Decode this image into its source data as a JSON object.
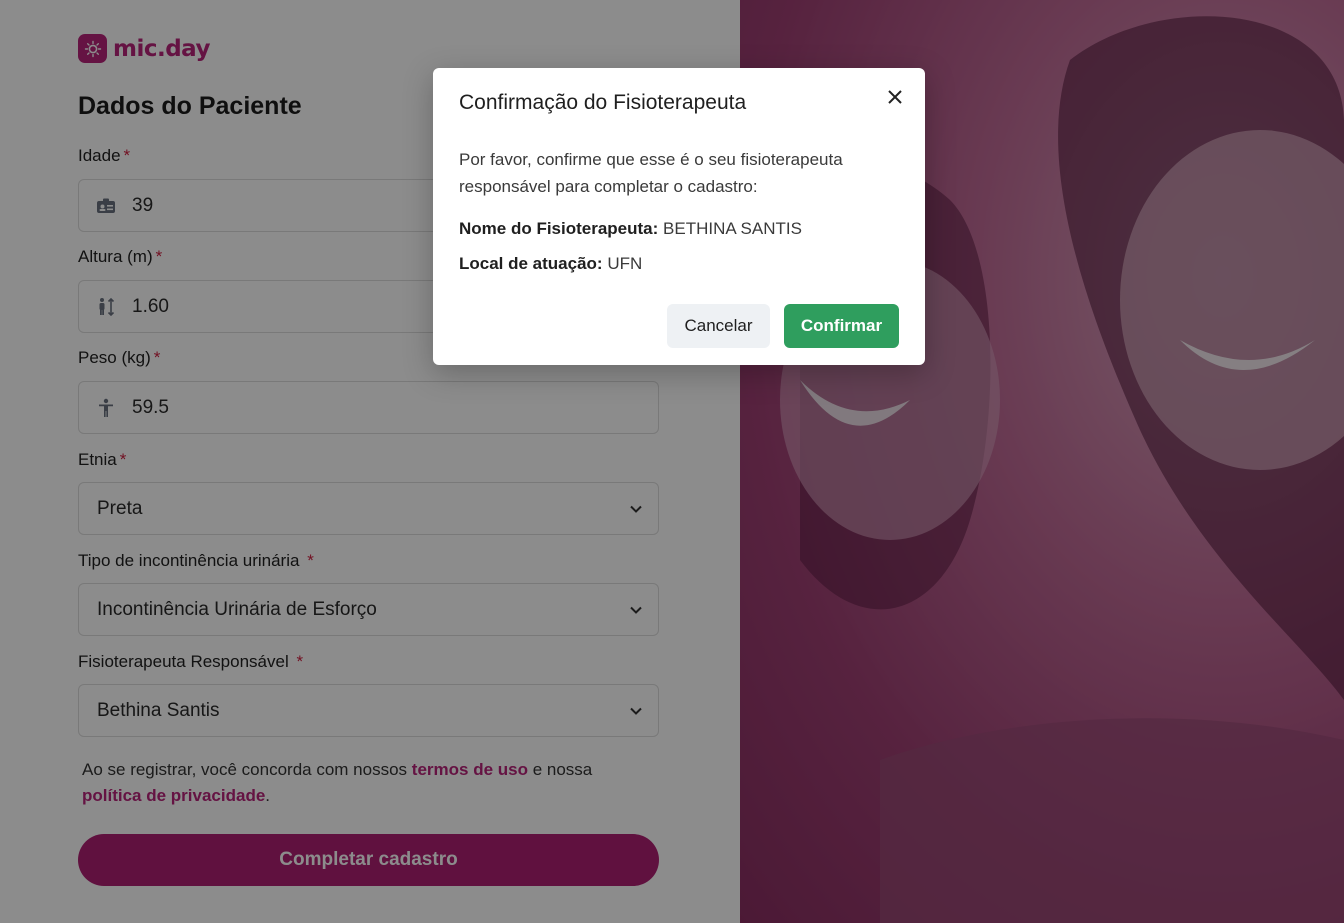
{
  "brand": {
    "name": "mic.day",
    "color": "#b8237a"
  },
  "page_title": "Dados do Paciente",
  "form": {
    "age": {
      "label": "Idade",
      "required_mark": "*",
      "value": "39",
      "icon": "id-card-icon"
    },
    "height": {
      "label": "Altura (m)",
      "required_mark": "*",
      "value": "1.60",
      "icon": "height-icon"
    },
    "weight": {
      "label": "Peso (kg)",
      "required_mark": "*",
      "value": "59.5",
      "icon": "person-icon"
    },
    "ethnicity": {
      "label": "Etnia",
      "required_mark": "*",
      "value": "Preta"
    },
    "incontinence_type": {
      "label": "Tipo de incontinência urinária",
      "required_mark": "*",
      "value": "Incontinência Urinária de Esforço"
    },
    "physio": {
      "label": "Fisioterapeuta Responsável",
      "required_mark": "*",
      "value": "Bethina Santis"
    }
  },
  "terms": {
    "prefix": "Ao se registrar, você concorda com nossos",
    "terms_link": "termos de uso",
    "middle": "e nossa",
    "privacy_link": "política de privacidade",
    "suffix": "."
  },
  "submit_label": "Completar cadastro",
  "modal": {
    "title": "Confirmação do Fisioterapeuta",
    "body": "Por favor, confirme que esse é o seu fisioterapeuta responsável para completar o cadastro:",
    "name_label": "Nome do Fisioterapeuta:",
    "name_value": "BETHINA SANTIS",
    "location_label": "Local de atuação:",
    "location_value": "UFN",
    "cancel_label": "Cancelar",
    "confirm_label": "Confirmar"
  },
  "colors": {
    "accent": "#b01f73",
    "confirm": "#2f9e5e",
    "required": "#d02040"
  }
}
